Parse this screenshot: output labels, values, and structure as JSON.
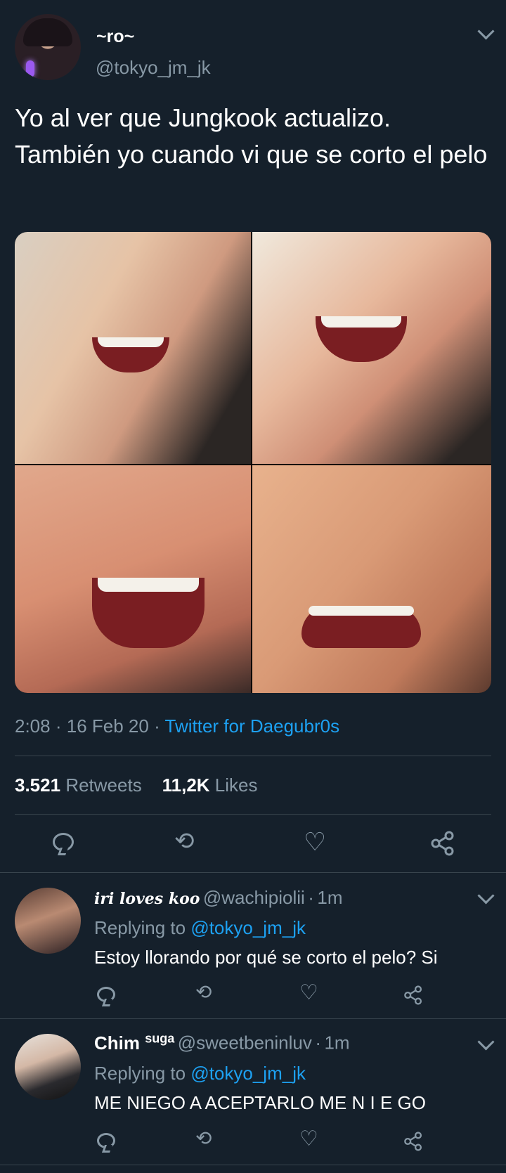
{
  "tweet": {
    "display_name": "~ro~",
    "handle": "@tokyo_jm_jk",
    "text": "Yo al ver que Jungkook actualizo. También yo cuando vi que se corto el pelo",
    "time": "2:08",
    "date": "16 Feb 20",
    "source": "Twitter for Daegubr0s",
    "retweets_count": "3.521",
    "retweets_label": "Retweets",
    "likes_count": "11,2K",
    "likes_label": "Likes"
  },
  "replies": [
    {
      "display_name": "iri loves koo",
      "handle": "@wachipiolii",
      "age": "1m",
      "replying_prefix": "Replying to",
      "replying_to": "@tokyo_jm_jk",
      "text": "Estoy llorando por qué se corto el pelo? Si"
    },
    {
      "display_name": "Chim",
      "display_name_sup": "suga",
      "handle": "@sweetbeninluv",
      "age": "1m",
      "replying_prefix": "Replying to",
      "replying_to": "@tokyo_jm_jk",
      "text": "ME NIEGO A ACEPTARLO ME N I E GO"
    }
  ],
  "separator": "·",
  "icons": [
    "reply-icon",
    "retweet-icon",
    "like-icon",
    "share-icon",
    "chevron-down-icon"
  ],
  "colors": {
    "background": "#15202b",
    "text": "#ffffff",
    "muted": "#8899a6",
    "link": "#1da1f2",
    "divider": "#38444d"
  }
}
